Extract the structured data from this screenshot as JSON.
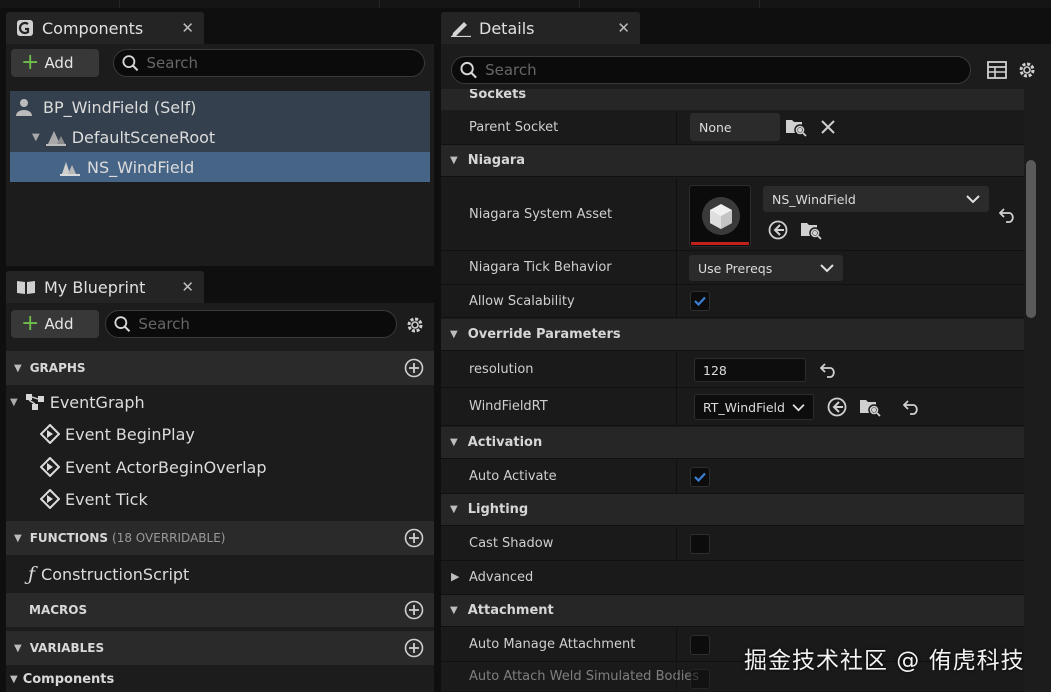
{
  "components_panel": {
    "title": "Components",
    "add_label": "Add",
    "search_placeholder": "Search",
    "tree": [
      {
        "label": "BP_WindField (Self)"
      },
      {
        "label": "DefaultSceneRoot"
      },
      {
        "label": "NS_WindField"
      }
    ]
  },
  "blueprint_panel": {
    "title": "My Blueprint",
    "add_label": "Add",
    "search_placeholder": "Search",
    "graphs_label": "GRAPHS",
    "event_graph": "EventGraph",
    "events": [
      "Event BeginPlay",
      "Event ActorBeginOverlap",
      "Event Tick"
    ],
    "functions_label": "FUNCTIONS",
    "functions_count": "(18 OVERRIDABLE)",
    "construction_script": "ConstructionScript",
    "macros_label": "MACROS",
    "variables_label": "VARIABLES",
    "components_label": "Components"
  },
  "details_panel": {
    "title": "Details",
    "search_placeholder": "Search",
    "sockets_label": "Sockets",
    "parent_socket_label": "Parent Socket",
    "parent_socket_value": "None",
    "niagara_label": "Niagara",
    "system_asset_label": "Niagara System Asset",
    "system_asset_value": "NS_WindField",
    "tick_behavior_label": "Niagara Tick Behavior",
    "tick_behavior_value": "Use Prereqs",
    "allow_scalability_label": "Allow Scalability",
    "override_label": "Override Parameters",
    "resolution_label": "resolution",
    "resolution_value": "128",
    "windfieldrt_label": "WindFieldRT",
    "windfieldrt_value": "RT_WindField",
    "activation_label": "Activation",
    "auto_activate_label": "Auto Activate",
    "lighting_label": "Lighting",
    "cast_shadow_label": "Cast Shadow",
    "advanced_label": "Advanced",
    "attachment_label": "Attachment",
    "auto_manage_label": "Auto Manage Attachment",
    "auto_weld_label": "Auto Attach Weld Simulated Bodies"
  },
  "watermark": "掘金技术社区 @ 侑虎科技",
  "colors": {
    "selection": "#466486",
    "check": "#3d7fd6",
    "add_plus": "#6fbf4a",
    "asset_underline": "#c0221a"
  }
}
